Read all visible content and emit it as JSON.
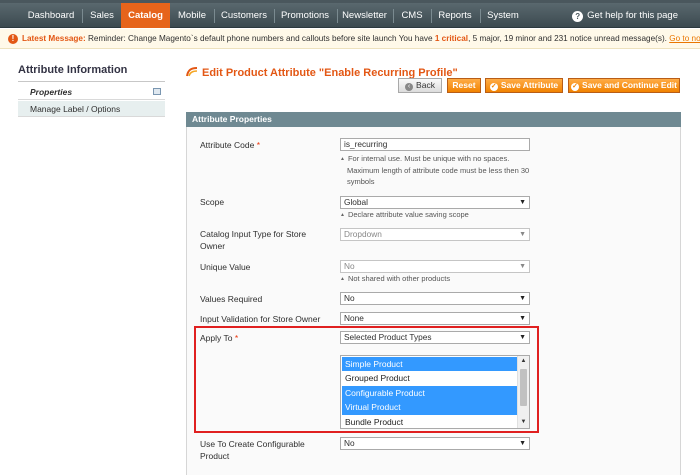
{
  "nav": {
    "items": [
      {
        "label": "Dashboard",
        "active": false
      },
      {
        "label": "Sales",
        "active": false
      },
      {
        "label": "Catalog",
        "active": true
      },
      {
        "label": "Mobile",
        "active": false
      },
      {
        "label": "Customers",
        "active": false
      },
      {
        "label": "Promotions",
        "active": false
      },
      {
        "label": "Newsletter",
        "active": false
      },
      {
        "label": "CMS",
        "active": false
      },
      {
        "label": "Reports",
        "active": false
      },
      {
        "label": "System",
        "active": false
      }
    ],
    "help_label": "Get help for this page"
  },
  "message": {
    "label": "Latest Message:",
    "text_before": " Reminder: Change Magento`s default phone numbers and callouts before site launch  You have ",
    "critical": "1 critical",
    "text_after": ", 5 major, 19 minor and 231 notice unread message(s). ",
    "link": "Go to notifications"
  },
  "sidebar": {
    "title": "Attribute Information",
    "items": [
      {
        "label": "Properties",
        "active": true
      },
      {
        "label": "Manage Label / Options",
        "active": false
      }
    ]
  },
  "header": {
    "title": "Edit Product Attribute \"Enable Recurring Profile\"",
    "buttons": {
      "back": "Back",
      "reset": "Reset",
      "save": "Save Attribute",
      "save_continue": "Save and Continue Edit"
    }
  },
  "fieldset": {
    "title": "Attribute Properties",
    "fields": {
      "attribute_code": {
        "label": "Attribute Code",
        "required": "*",
        "value": "is_recurring",
        "note_1": "For internal use. Must be unique with no spaces.",
        "note_2": "Maximum length of attribute code must be less then 30",
        "note_3": "symbols"
      },
      "scope": {
        "label": "Scope",
        "value": "Global",
        "note": "Declare attribute value saving scope"
      },
      "input_type": {
        "label_1": "Catalog Input Type for Store",
        "label_2": "Owner",
        "value": "Dropdown"
      },
      "unique": {
        "label": "Unique Value",
        "value": "No",
        "note": "Not shared with other products"
      },
      "values_required": {
        "label": "Values Required",
        "value": "No"
      },
      "validation": {
        "label": "Input Validation for Store Owner",
        "value": "None"
      },
      "apply_to": {
        "label": "Apply To",
        "required": "*",
        "value": "Selected Product Types",
        "options": [
          {
            "label": "Simple Product",
            "selected": true
          },
          {
            "label": "Grouped Product",
            "selected": false
          },
          {
            "label": "Configurable Product",
            "selected": true
          },
          {
            "label": "Virtual Product",
            "selected": true
          },
          {
            "label": "Bundle Product",
            "selected": false
          }
        ]
      },
      "configurable": {
        "label_1": "Use To Create Configurable",
        "label_2": "Product",
        "value": "No"
      }
    }
  },
  "colors": {
    "accent": "#e35714",
    "nav_active": "#e6641b",
    "selection": "#3399ff",
    "highlight_box": "#e02020"
  }
}
